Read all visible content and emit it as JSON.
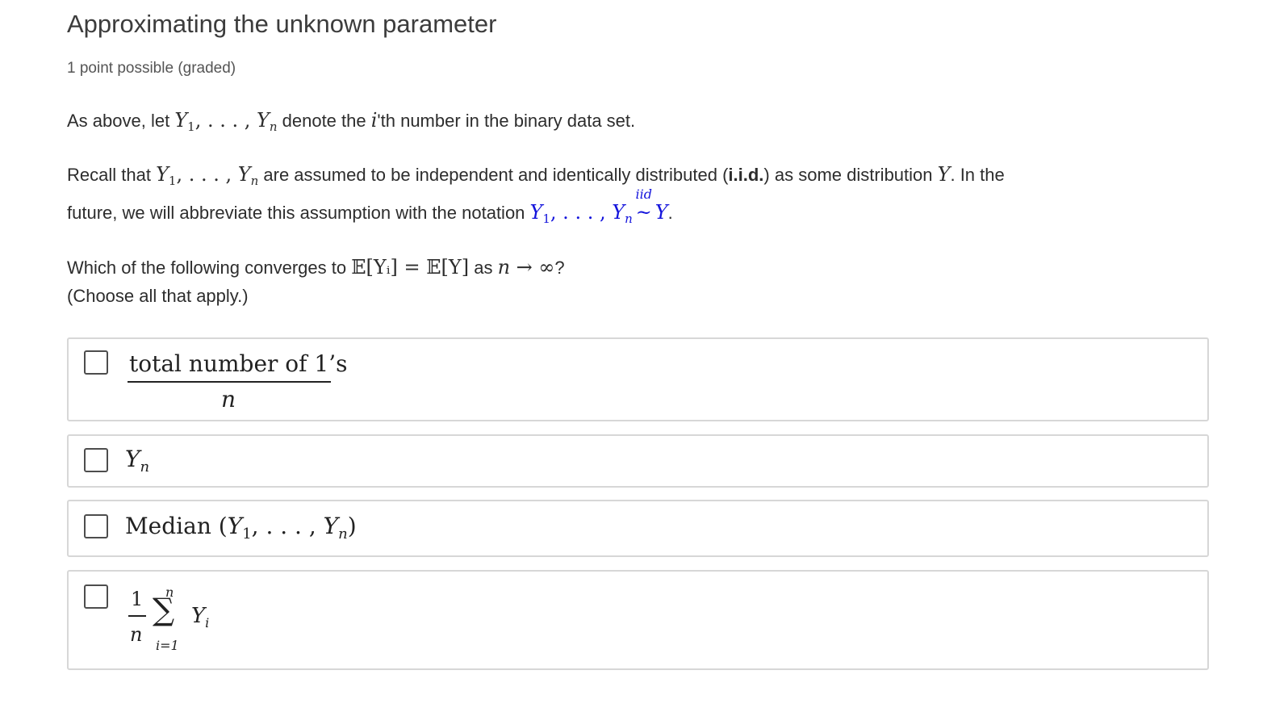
{
  "problem": {
    "title": "Approximating the unknown parameter",
    "points": "1 point possible (graded)"
  },
  "para1": {
    "before": "As above, let ",
    "after": " denote the ",
    "i": "i",
    "tail": "'th number in the binary data set."
  },
  "para2": {
    "line1_a": "Recall that ",
    "line1_b": " are assumed to be independent and identically distributed (",
    "iid_bold": "i.i.d.",
    "line1_c": ") as some distribution ",
    "line1_d": ". In the",
    "line2_a": "future, we will abbreviate this assumption with the notation ",
    "iid_over": "iid"
  },
  "question": {
    "a": "Which of the following converges to ",
    "expectation": "𝔼[Yᵢ] = 𝔼[Y]",
    "as": " as ",
    "limit": "n → ∞",
    "end": "?",
    "note": "(Choose all that apply.)"
  },
  "seq": {
    "Y": "Y",
    "one": "1",
    "dots": ", . . . , ",
    "n": "n",
    "comma": ","
  },
  "choices": [
    {
      "numerator": "total number of 1’s",
      "denominator": "n"
    },
    {
      "symbol": "Y",
      "sub": "n"
    },
    {
      "word": "Median",
      "open": "(",
      "close": ")"
    },
    {
      "one": "1",
      "n": "n",
      "upper": "n",
      "lower": "i=1",
      "sigma": "∑",
      "term": "Y",
      "sub": "i"
    }
  ],
  "colors": {
    "accent": "#1414dc",
    "border": "#d7d7d7"
  }
}
